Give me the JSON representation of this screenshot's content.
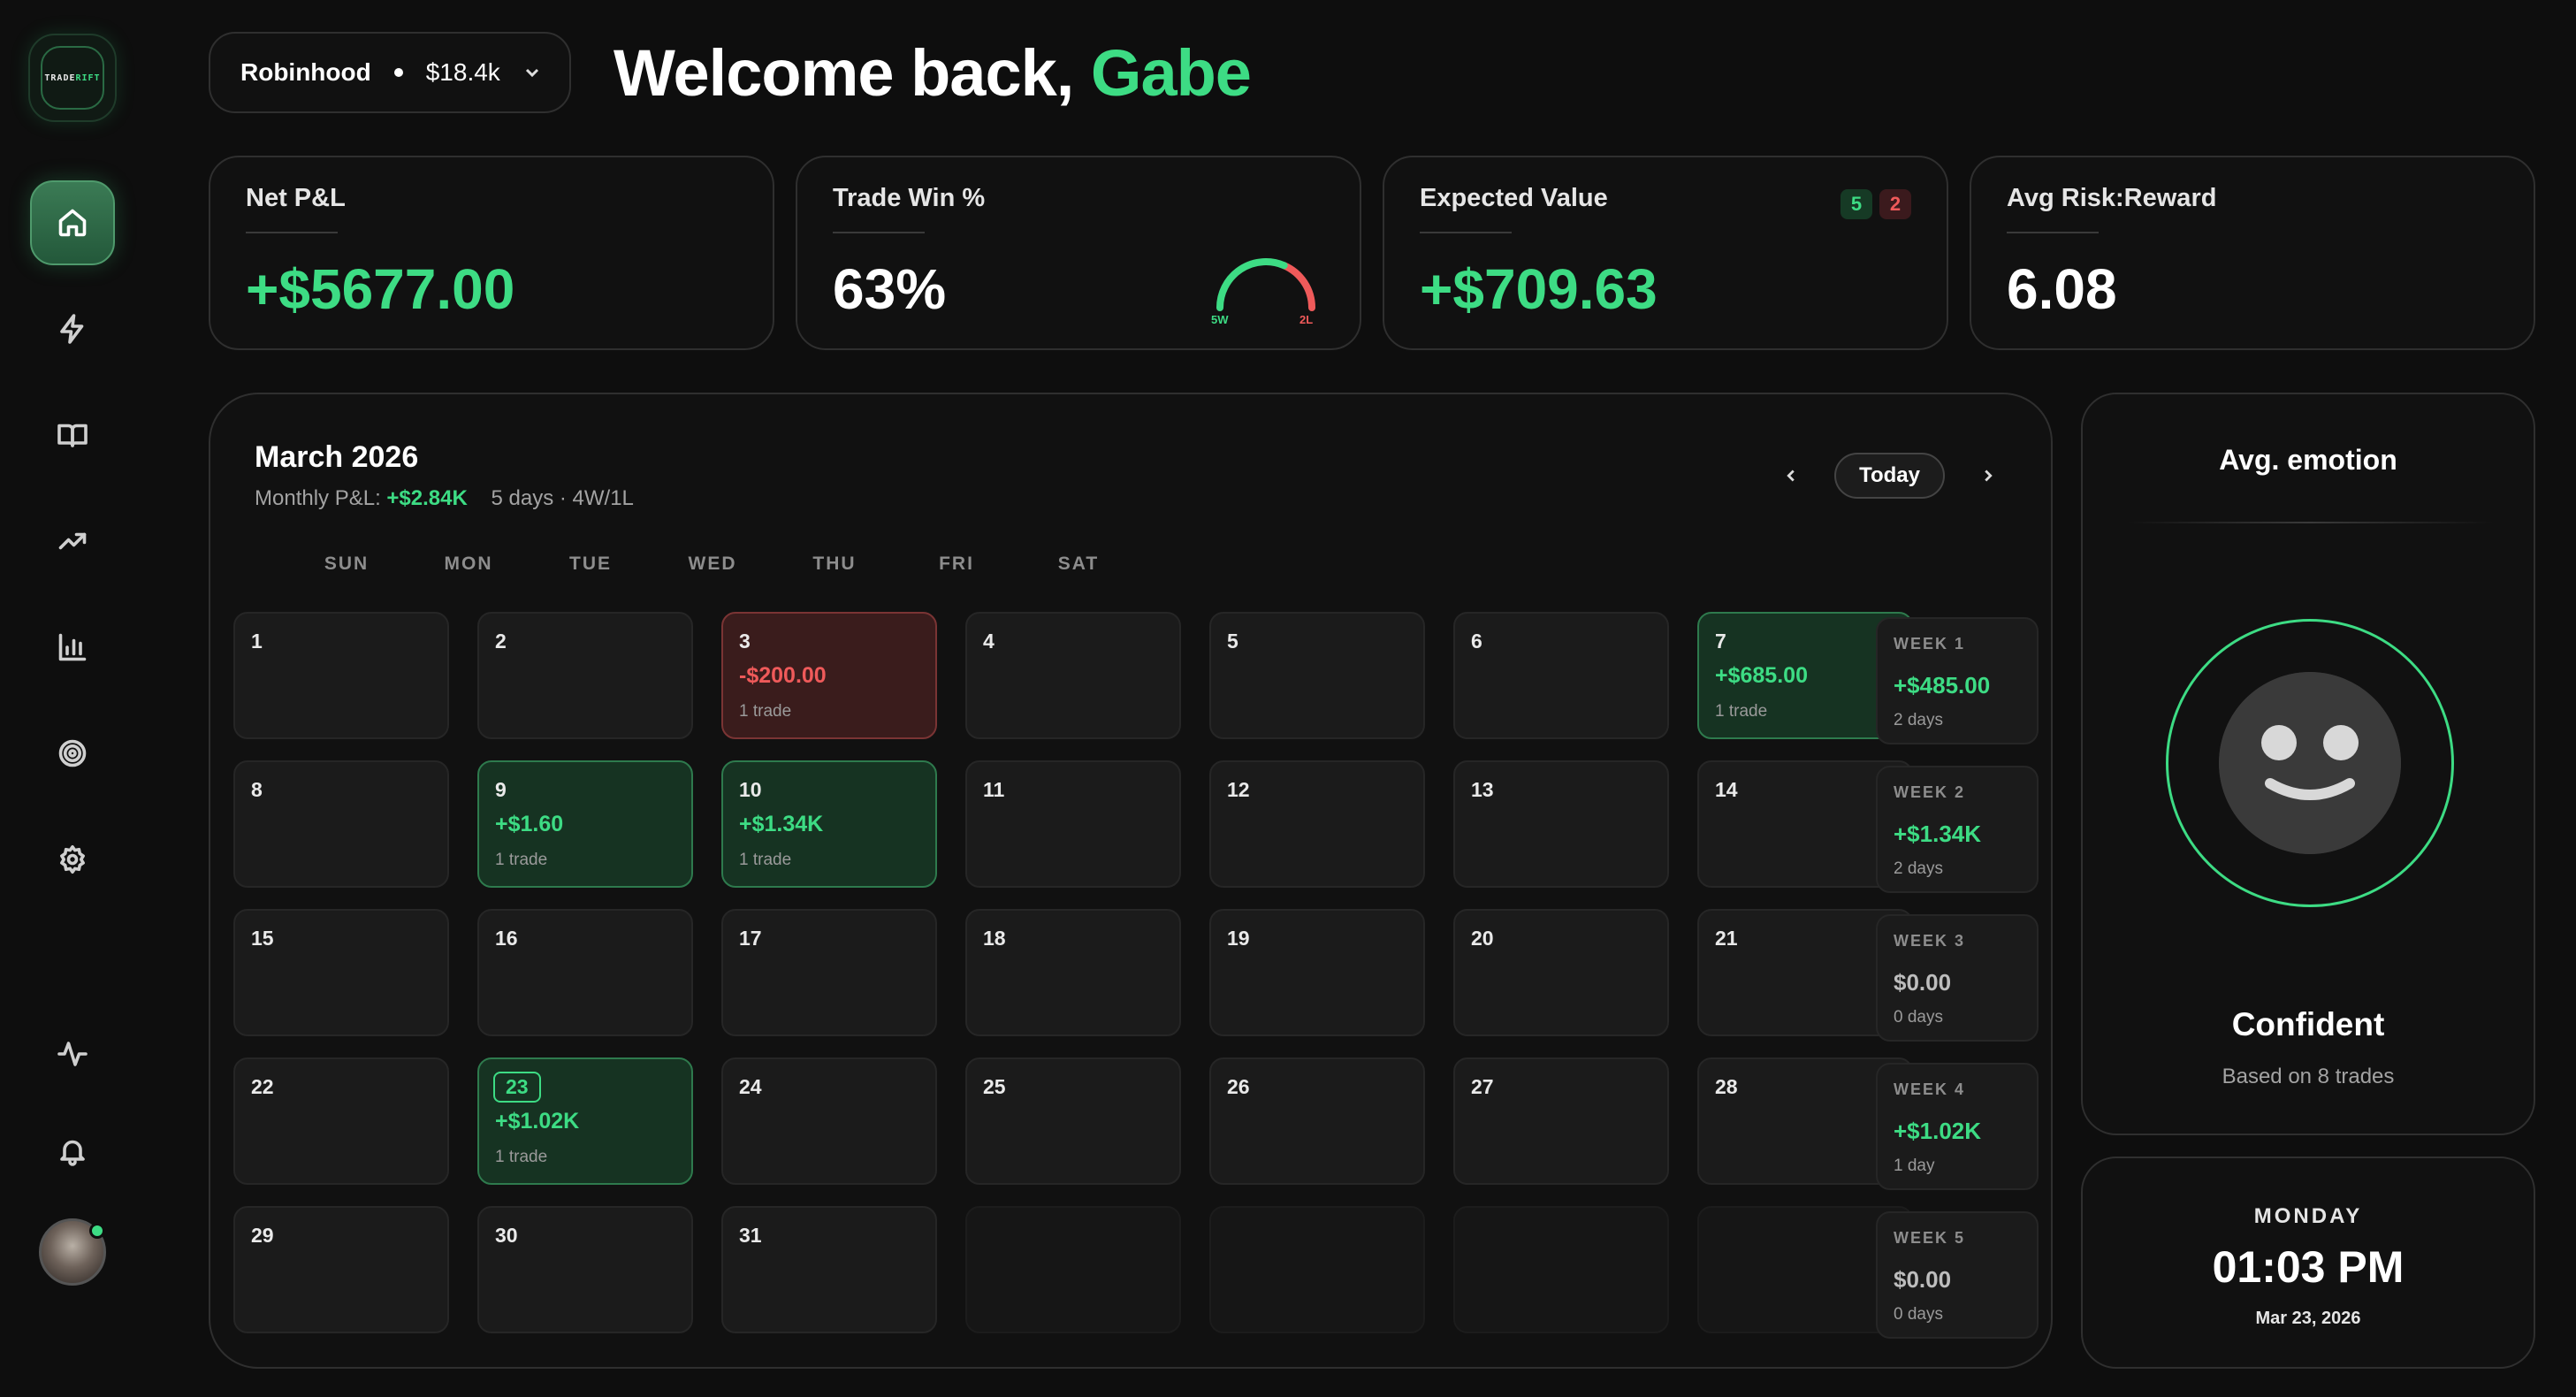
{
  "app": {
    "logo_text_a": "TRADE",
    "logo_text_b": "RIFT",
    "accent_color": "#3ddc84",
    "loss_color": "#ef5a5a"
  },
  "sidebar": {
    "items": [
      {
        "name": "home",
        "icon": "home-icon",
        "active": true
      },
      {
        "name": "trades",
        "icon": "lightning-icon",
        "active": false
      },
      {
        "name": "journal",
        "icon": "book-icon",
        "active": false
      },
      {
        "name": "performance",
        "icon": "trending-up-icon",
        "active": false
      },
      {
        "name": "reports",
        "icon": "bar-chart-icon",
        "active": false
      },
      {
        "name": "goals",
        "icon": "target-icon",
        "active": false
      },
      {
        "name": "settings",
        "icon": "gear-icon",
        "active": false
      }
    ],
    "bottom_items": [
      {
        "name": "activity",
        "icon": "pulse-icon"
      },
      {
        "name": "notifications",
        "icon": "bell-icon"
      }
    ]
  },
  "header": {
    "account_name": "Robinhood",
    "account_balance": "$18.4k",
    "welcome_prefix": "Welcome back,",
    "user_name": "Gabe"
  },
  "stats": {
    "net_pl": {
      "label": "Net P&L",
      "value": "+$5677.00"
    },
    "win_rate": {
      "label": "Trade Win %",
      "value": "63%",
      "wins_label": "5W",
      "losses_label": "2L",
      "win_fraction": 0.63
    },
    "expected_value": {
      "label": "Expected Value",
      "value": "+$709.63",
      "wins": "5",
      "losses": "2"
    },
    "risk_reward": {
      "label": "Avg Risk:Reward",
      "value": "6.08"
    }
  },
  "calendar": {
    "title": "March 2026",
    "monthly_label": "Monthly P&L:",
    "monthly_pl": "+$2.84K",
    "meta": "5 days · 4W/1L",
    "today_label": "Today",
    "weekdays": [
      "SUN",
      "MON",
      "TUE",
      "WED",
      "THU",
      "FRI",
      "SAT"
    ],
    "days": [
      {
        "num": "1"
      },
      {
        "num": "2"
      },
      {
        "num": "3",
        "pl": "-$200.00",
        "trades": "1 trade",
        "status": "loss"
      },
      {
        "num": "4"
      },
      {
        "num": "5"
      },
      {
        "num": "6"
      },
      {
        "num": "7",
        "pl": "+$685.00",
        "trades": "1 trade",
        "status": "win"
      },
      {
        "num": "8"
      },
      {
        "num": "9",
        "pl": "+$1.60",
        "trades": "1 trade",
        "status": "win"
      },
      {
        "num": "10",
        "pl": "+$1.34K",
        "trades": "1 trade",
        "status": "win"
      },
      {
        "num": "11"
      },
      {
        "num": "12"
      },
      {
        "num": "13"
      },
      {
        "num": "14"
      },
      {
        "num": "15"
      },
      {
        "num": "16"
      },
      {
        "num": "17"
      },
      {
        "num": "18"
      },
      {
        "num": "19"
      },
      {
        "num": "20"
      },
      {
        "num": "21"
      },
      {
        "num": "22"
      },
      {
        "num": "23",
        "pl": "+$1.02K",
        "trades": "1 trade",
        "status": "win",
        "today": true
      },
      {
        "num": "24"
      },
      {
        "num": "25"
      },
      {
        "num": "26"
      },
      {
        "num": "27"
      },
      {
        "num": "28"
      },
      {
        "num": "29"
      },
      {
        "num": "30"
      },
      {
        "num": "31"
      },
      {
        "num": ""
      },
      {
        "num": ""
      },
      {
        "num": ""
      },
      {
        "num": ""
      }
    ],
    "weeks": [
      {
        "label": "WEEK 1",
        "pl": "+$485.00",
        "days": "2 days"
      },
      {
        "label": "WEEK 2",
        "pl": "+$1.34K",
        "days": "2 days"
      },
      {
        "label": "WEEK 3",
        "pl": "$0.00",
        "days": "0 days"
      },
      {
        "label": "WEEK 4",
        "pl": "+$1.02K",
        "days": "1 day"
      },
      {
        "label": "WEEK 5",
        "pl": "$0.00",
        "days": "0 days"
      }
    ]
  },
  "emotion": {
    "title": "Avg. emotion",
    "icon": "smiley-face-icon",
    "label": "Confident",
    "sub": "Based on 8 trades"
  },
  "clock": {
    "day": "MONDAY",
    "time": "01:03 PM",
    "date": "Mar 23, 2026"
  }
}
